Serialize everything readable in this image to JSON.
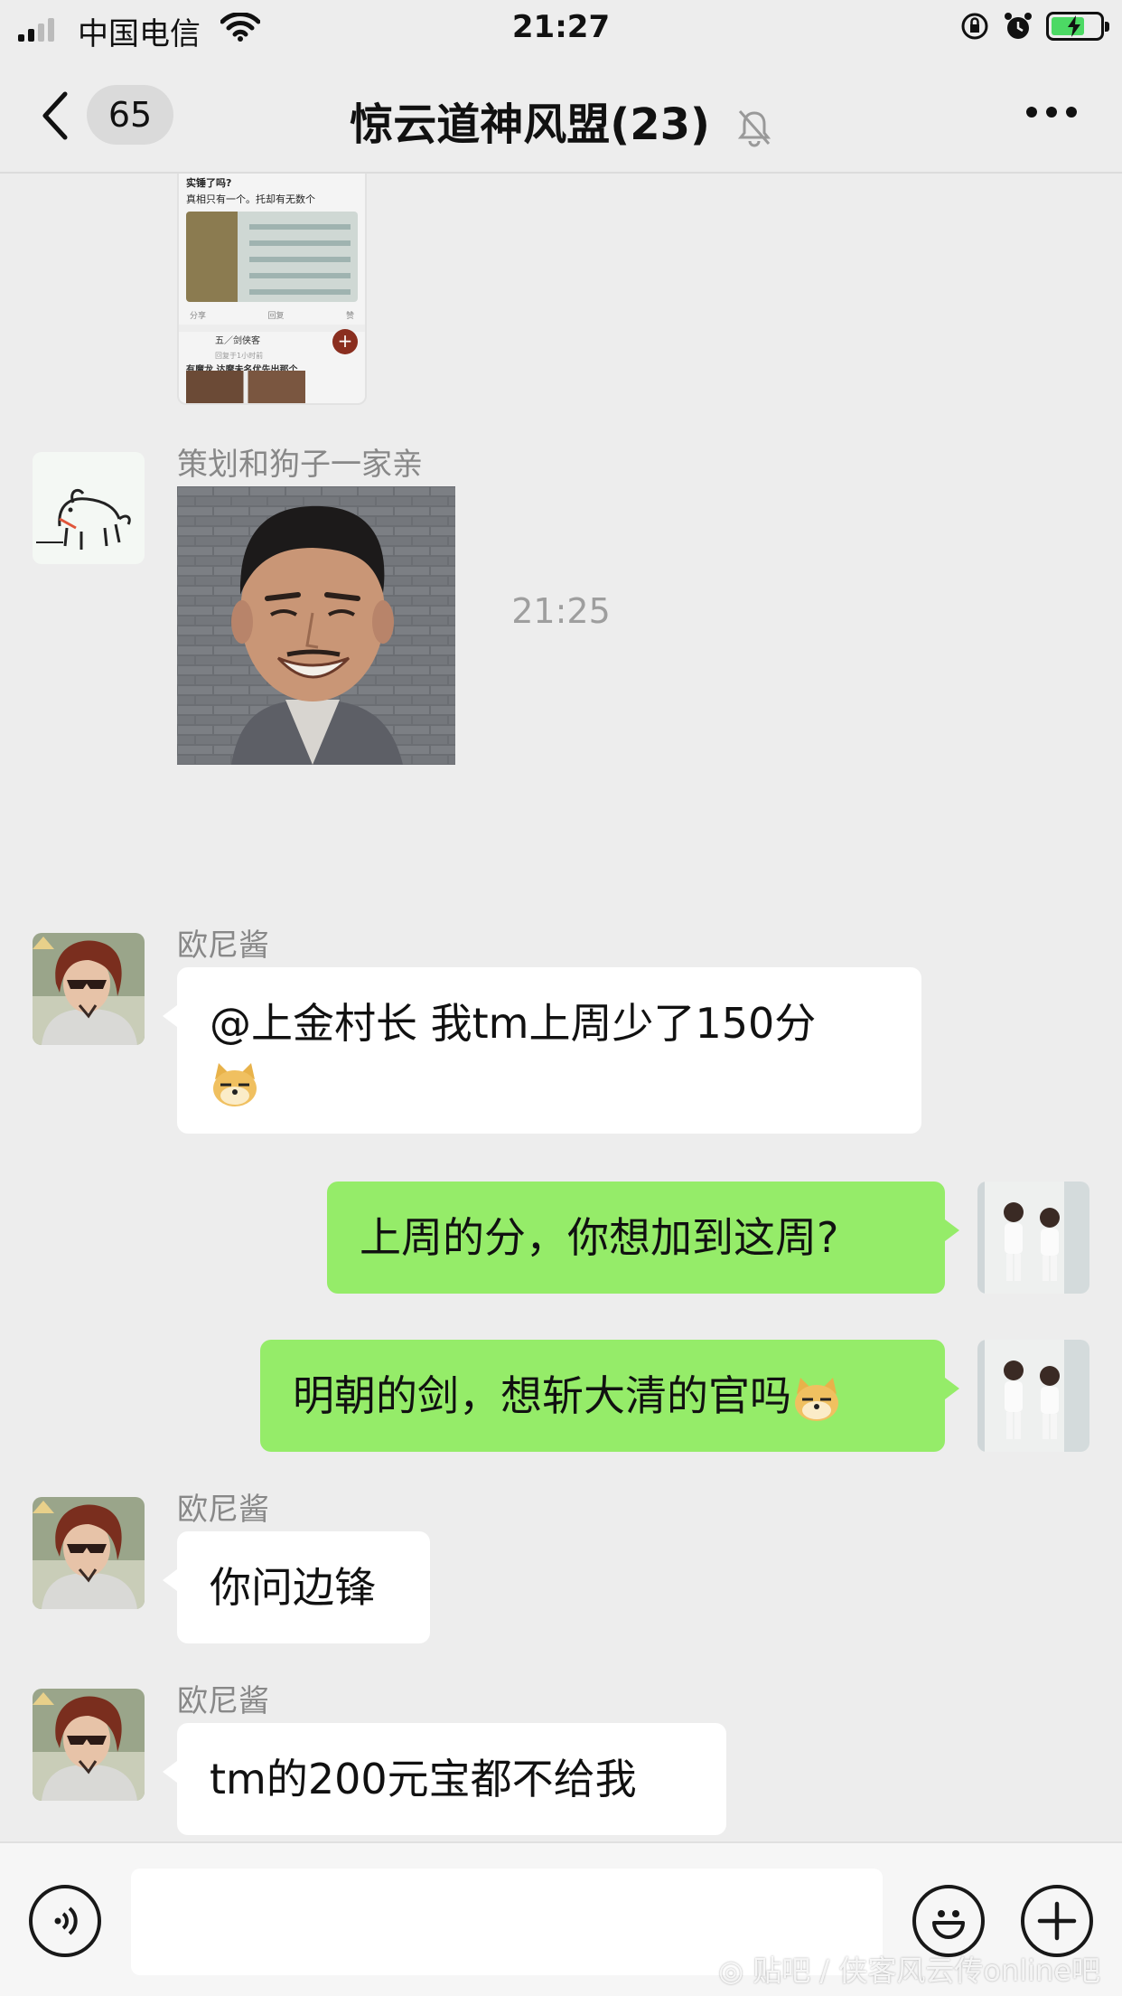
{
  "status_bar": {
    "carrier": "中国电信",
    "time": "21:27",
    "battery_level": 0.7,
    "signal_bars_filled": 2
  },
  "nav": {
    "back_icon": "chevron-left-icon",
    "unread_count": "65",
    "title": "惊云道神风盟(23)",
    "mute_icon": "bell-slash-icon",
    "more_icon": "ellipsis-icon"
  },
  "thumbnail": {
    "line1": "实锤了吗?",
    "line2": "真相只有一个。托却有无数个",
    "share": "分享",
    "reply": "回复",
    "like": "赞",
    "user": "五／剑侠客",
    "user_sub": "回复于1小时前",
    "snippet": "有魔龙 达摩未名优先出那个"
  },
  "messages": [
    {
      "sender": "策划和狗子一家亲",
      "type": "image"
    },
    {
      "timestamp": "21:25"
    },
    {
      "sender": "欧尼酱",
      "text": "@上金村长 我tm上周少了150分"
    },
    {
      "direction": "out",
      "text": "上周的分，你想加到这周?"
    },
    {
      "direction": "out",
      "text": "明朝的剑，想斩大清的官吗"
    },
    {
      "sender": "欧尼酱",
      "text": "你问边锋"
    },
    {
      "sender": "欧尼酱",
      "text": "tm的200元宝都不给我"
    }
  ],
  "input_bar": {
    "voice_icon": "voice-icon",
    "emoji_icon": "smiley-icon",
    "plus_icon": "plus-icon",
    "value": ""
  },
  "watermark": "◎ 贴吧 / 侠客风云传online吧"
}
